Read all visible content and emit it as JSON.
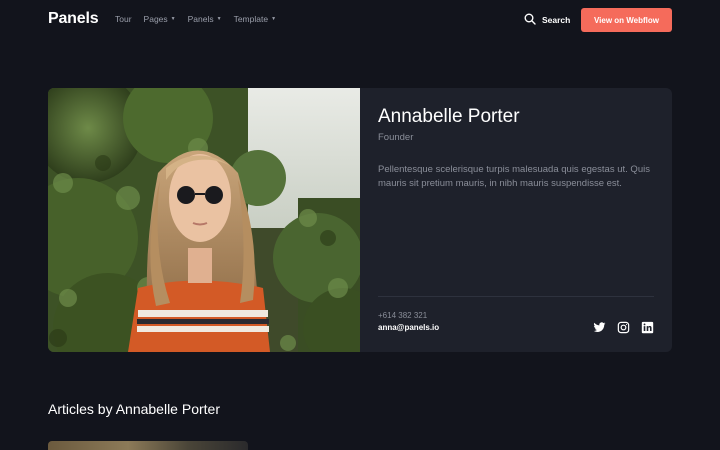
{
  "nav": {
    "brand": "Panels",
    "menu": [
      {
        "label": "Tour",
        "dropdown": false
      },
      {
        "label": "Pages",
        "dropdown": true
      },
      {
        "label": "Panels",
        "dropdown": true
      },
      {
        "label": "Template",
        "dropdown": true
      }
    ],
    "search_label": "Search",
    "search_icon": "search-icon",
    "cta_label": "View on Webflow"
  },
  "profile": {
    "name": "Annabelle Porter",
    "role": "Founder",
    "bio": "Pellentesque scelerisque turpis malesuada quis egestas ut. Quis mauris sit pretium mauris, in nibh mauris suspendisse est.",
    "phone": "+614 382 321",
    "email": "anna@panels.io",
    "socials": [
      "twitter-icon",
      "instagram-icon",
      "linkedin-icon"
    ]
  },
  "articles": {
    "heading": "Articles by Annabelle Porter"
  },
  "colors": {
    "background": "#12141c",
    "card": "#1e212b",
    "accent": "#f56b5b",
    "muted_text": "#8a8e99"
  }
}
